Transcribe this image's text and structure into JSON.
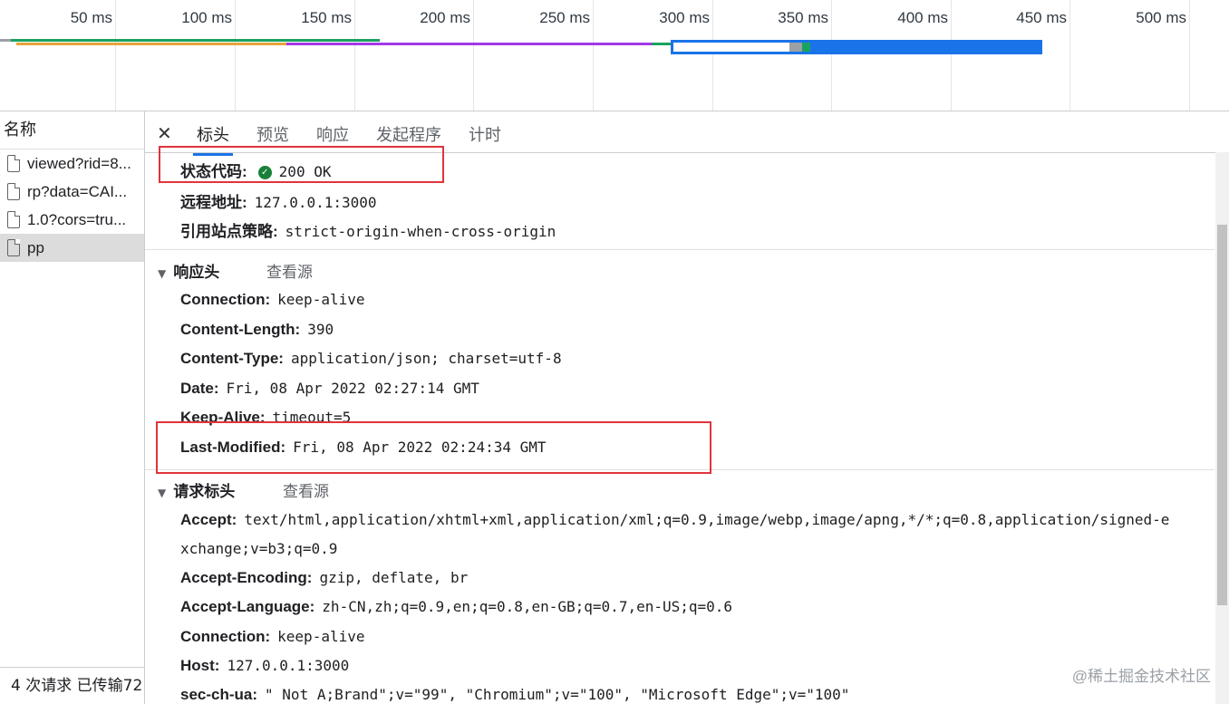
{
  "timeline": {
    "ticks": [
      "50 ms",
      "100 ms",
      "150 ms",
      "200 ms",
      "250 ms",
      "300 ms",
      "350 ms",
      "400 ms",
      "450 ms",
      "500 ms"
    ],
    "colors": {
      "green": "#1aa260",
      "orange": "#e8a33d",
      "purple": "#a338e8",
      "blue": "#1a73e8",
      "gray": "#9aa0a6"
    }
  },
  "left": {
    "name_header": "名称",
    "requests": [
      {
        "label": "viewed?rid=8..."
      },
      {
        "label": "rp?data=CAI..."
      },
      {
        "label": "1.0?cors=tru..."
      },
      {
        "label": "pp"
      }
    ],
    "status": "4 次请求  已传输72"
  },
  "tabs": [
    "标头",
    "预览",
    "响应",
    "发起程序",
    "计时"
  ],
  "general": {
    "status_key": "状态代码:",
    "status_val": "200 OK",
    "remote_key": "远程地址:",
    "remote_val": "127.0.0.1:3000",
    "referrer_key": "引用站点策略:",
    "referrer_val": "strict-origin-when-cross-origin"
  },
  "response_headers": {
    "title": "响应头",
    "view_source": "查看源",
    "items": [
      {
        "k": "Connection:",
        "v": "keep-alive"
      },
      {
        "k": "Content-Length:",
        "v": "390"
      },
      {
        "k": "Content-Type:",
        "v": "application/json; charset=utf-8"
      },
      {
        "k": "Date:",
        "v": "Fri, 08 Apr 2022 02:27:14 GMT"
      },
      {
        "k": "Keep-Alive:",
        "v": "timeout=5"
      },
      {
        "k": "Last-Modified:",
        "v": "Fri, 08 Apr 2022 02:24:34 GMT"
      }
    ]
  },
  "request_headers": {
    "title": "请求标头",
    "view_source": "查看源",
    "accept_k": "Accept:",
    "accept_v1": "text/html,application/xhtml+xml,application/xml;q=0.9,image/webp,image/apng,*/*;q=0.8,application/signed-e",
    "accept_v2": "xchange;v=b3;q=0.9",
    "items": [
      {
        "k": "Accept-Encoding:",
        "v": "gzip, deflate, br"
      },
      {
        "k": "Accept-Language:",
        "v": "zh-CN,zh;q=0.9,en;q=0.8,en-GB;q=0.7,en-US;q=0.6"
      },
      {
        "k": "Connection:",
        "v": "keep-alive"
      },
      {
        "k": "Host:",
        "v": "127.0.0.1:3000"
      },
      {
        "k": "sec-ch-ua:",
        "v": "\" Not A;Brand\";v=\"99\", \"Chromium\";v=\"100\", \"Microsoft Edge\";v=\"100\""
      }
    ]
  },
  "watermark": "@稀土掘金技术社区"
}
